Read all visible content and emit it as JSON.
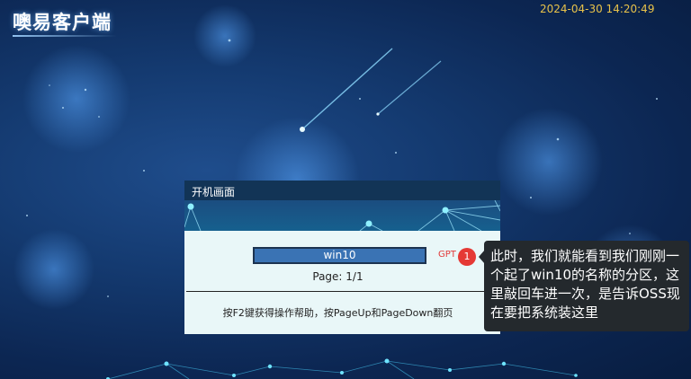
{
  "app": {
    "title": "噢易客户端"
  },
  "clock": "2024-04-30 14:20:49",
  "boot_window": {
    "title": "开机画面",
    "selected_os": "win10",
    "page_indicator": "Page: 1/1",
    "help_text": "按F2键获得操作帮助，按PageUp和PageDown翻页"
  },
  "annotation": {
    "label": "GPT",
    "badge": "1",
    "text": "此时，我们就能看到我们刚刚一个起了win10的名称的分区，这里敲回车进一次，是告诉OSS现在要把系统装这里"
  },
  "colors": {
    "background": "#143a70",
    "clock": "#e8c24a",
    "selection": "#3a73b4",
    "badge": "#e53935",
    "callout": "#24292d"
  }
}
